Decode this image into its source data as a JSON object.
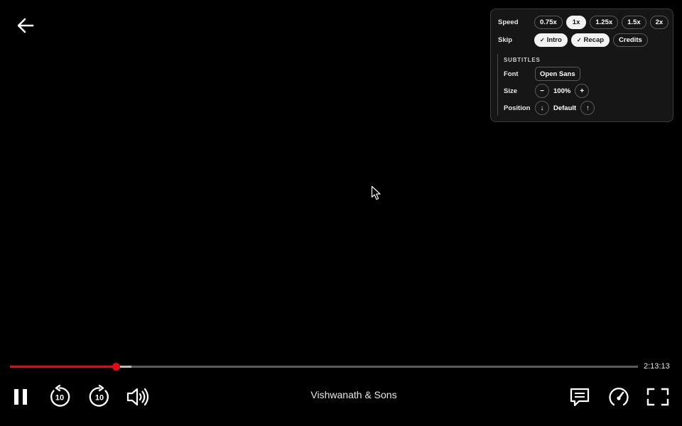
{
  "player": {
    "title": "Vishwanath & Sons",
    "duration_remaining": "2:13:13",
    "progress_fraction": 0.169,
    "buffered_fraction": 0.193
  },
  "colors": {
    "accent": "#e50914",
    "background": "#000000",
    "panel": "#161616"
  },
  "icons": {
    "back": "arrow-left-icon",
    "play_pause": "pause-icon",
    "rewind": "rewind-10-icon",
    "forward": "forward-10-icon",
    "volume": "volume-icon",
    "subtitles": "subtitles-icon",
    "speed": "speedometer-icon",
    "fullscreen": "fullscreen-icon",
    "cursor": "mouse-pointer-icon"
  },
  "controls": {
    "rewind_seconds": "10",
    "forward_seconds": "10"
  },
  "panel": {
    "speed": {
      "label": "Speed",
      "options": [
        "0.75x",
        "1x",
        "1.25x",
        "1.5x",
        "2x"
      ],
      "selected": "1x"
    },
    "skip": {
      "label": "Skip",
      "options": [
        {
          "label": "Intro",
          "checked": true
        },
        {
          "label": "Recap",
          "checked": true
        },
        {
          "label": "Credits",
          "checked": false
        }
      ]
    },
    "subtitles": {
      "title": "SUBTITLES",
      "font": {
        "label": "Font",
        "value": "Open Sans"
      },
      "size": {
        "label": "Size",
        "value": "100%",
        "decrease": "−",
        "increase": "+"
      },
      "position": {
        "label": "Position",
        "value": "Default",
        "down": "↓",
        "up": "↑"
      }
    }
  }
}
